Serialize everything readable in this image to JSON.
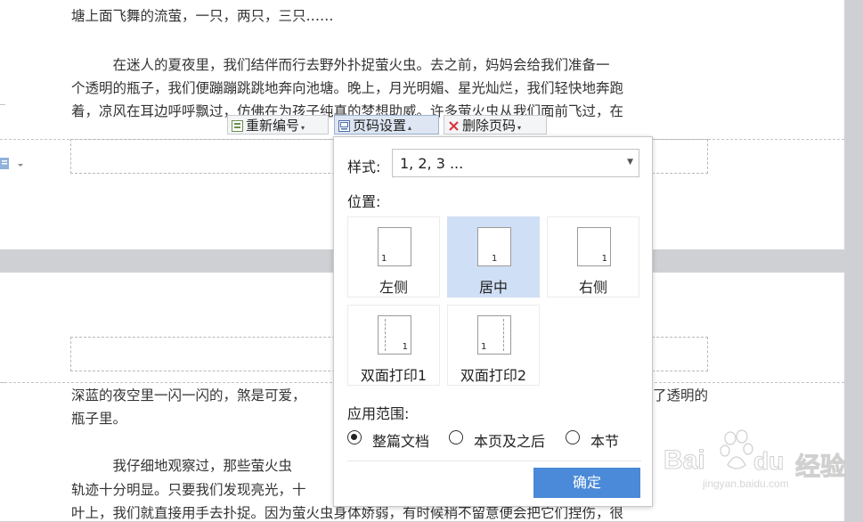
{
  "document": {
    "page1_lines": [
      "塘上面飞舞的流萤，一只，两只，三只……",
      "　　　在迷人的夏夜里，我们结伴而行去野外扑捉萤火虫。去之前，妈妈会给我们准备一",
      "个透明的瓶子，我们便蹦蹦跳跳地奔向池塘。晚上，月光明媚、星光灿烂，我们轻快地奔跑",
      "着，凉风在耳边呼呼飘过，仿佛在为孩子纯真的梦想助威。许多萤火虫从我们面前飞过，在"
    ],
    "page2_lines": [
      "深蓝的夜空里一闪一闪的，煞是可爱，",
      "瓶子里。",
      "　　　我仔细地观察过，那些萤火虫",
      "轨迹十分明显。只要我们发现亮光，十",
      "叶上，我们就直接用手去扑捉。因为萤火虫身体娇弱，有时候稍不留意便会把它们捏伤，很"
    ],
    "page2_right_fragment": "了透明的"
  },
  "toolbar": {
    "renumber_label": "重新编号",
    "page_setup_label": "页码设置",
    "delete_label": "删除页码"
  },
  "popup": {
    "style_label": "样式:",
    "style_value": "1, 2, 3 ...",
    "position_label": "位置:",
    "positions": [
      {
        "label": "左侧",
        "num": "1"
      },
      {
        "label": "居中",
        "num": "1"
      },
      {
        "label": "右侧",
        "num": "1"
      },
      {
        "label": "双面打印1",
        "num": "1"
      },
      {
        "label": "双面打印2",
        "num": "1"
      }
    ],
    "selected_position": "居中",
    "scope_label": "应用范围:",
    "scope_options": [
      "整篇文档",
      "本页及之后",
      "本节"
    ],
    "selected_scope": "整篇文档",
    "ok_label": "确定"
  },
  "watermark": {
    "brand": "Bai",
    "brand2": "du",
    "cn": "经验",
    "url": "jingyan.baidu.com"
  },
  "colors": {
    "accent": "#4a8ad8",
    "selected_tile": "#cfdff5",
    "delete_icon": "#d9363e"
  },
  "icons": [
    "page-icon",
    "renumber-icon",
    "page-setup-icon",
    "delete-x-icon",
    "paw-icon"
  ]
}
